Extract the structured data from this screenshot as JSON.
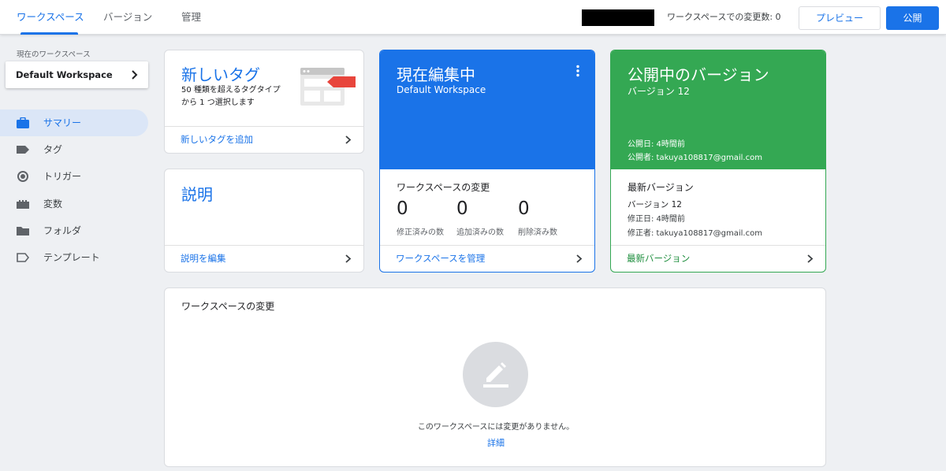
{
  "tabs": [
    {
      "label": "ワークスペース",
      "active": true
    },
    {
      "label": "バージョン",
      "active": false
    },
    {
      "label": "管理",
      "active": false
    }
  ],
  "header": {
    "change_count": "ワークスペースでの変更数: 0",
    "preview_label": "プレビュー",
    "publish_label": "公開"
  },
  "sidebar": {
    "workspace_caption": "現在のワークスペース",
    "workspace_name": "Default Workspace",
    "items": [
      {
        "label": "サマリー",
        "icon": "briefcase-icon",
        "active": true
      },
      {
        "label": "タグ",
        "icon": "tag-icon",
        "active": false
      },
      {
        "label": "トリガー",
        "icon": "trigger-icon",
        "active": false
      },
      {
        "label": "変数",
        "icon": "variable-icon",
        "active": false
      },
      {
        "label": "フォルダ",
        "icon": "folder-icon",
        "active": false
      },
      {
        "label": "テンプレート",
        "icon": "template-icon",
        "active": false
      }
    ]
  },
  "new_tag_card": {
    "title": "新しいタグ",
    "description": "50 種類を超えるタグタイプから 1 つ選択します",
    "link": "新しいタグを追加"
  },
  "description_card": {
    "title": "説明",
    "link": "説明を編集"
  },
  "editing_card": {
    "title": "現在編集中",
    "subtitle": "Default Workspace",
    "section_title": "ワークスペースの変更",
    "stats": [
      {
        "value": "0",
        "label": "修正済みの数"
      },
      {
        "value": "0",
        "label": "追加済みの数"
      },
      {
        "value": "0",
        "label": "削除済み数"
      }
    ],
    "link": "ワークスペースを管理"
  },
  "published_card": {
    "title": "公開中のバージョン",
    "subtitle": "バージョン 12",
    "published_date": "公開日: 4時間前",
    "published_by": "公開者: takuya108817@gmail.com",
    "section_title": "最新バージョン",
    "version": "バージョン 12",
    "modified_date": "修正日: 4時間前",
    "modified_by": "修正者: takuya108817@gmail.com",
    "link": "最新バージョン"
  },
  "changes_card": {
    "title": "ワークスペースの変更",
    "empty_message": "このワークスペースには変更がありません。",
    "details_link": "詳細"
  },
  "colors": {
    "accent": "#1a73e8",
    "editing_bg": "#1a73e8",
    "published_bg": "#34a853",
    "published_link": "#1e8e3e"
  }
}
